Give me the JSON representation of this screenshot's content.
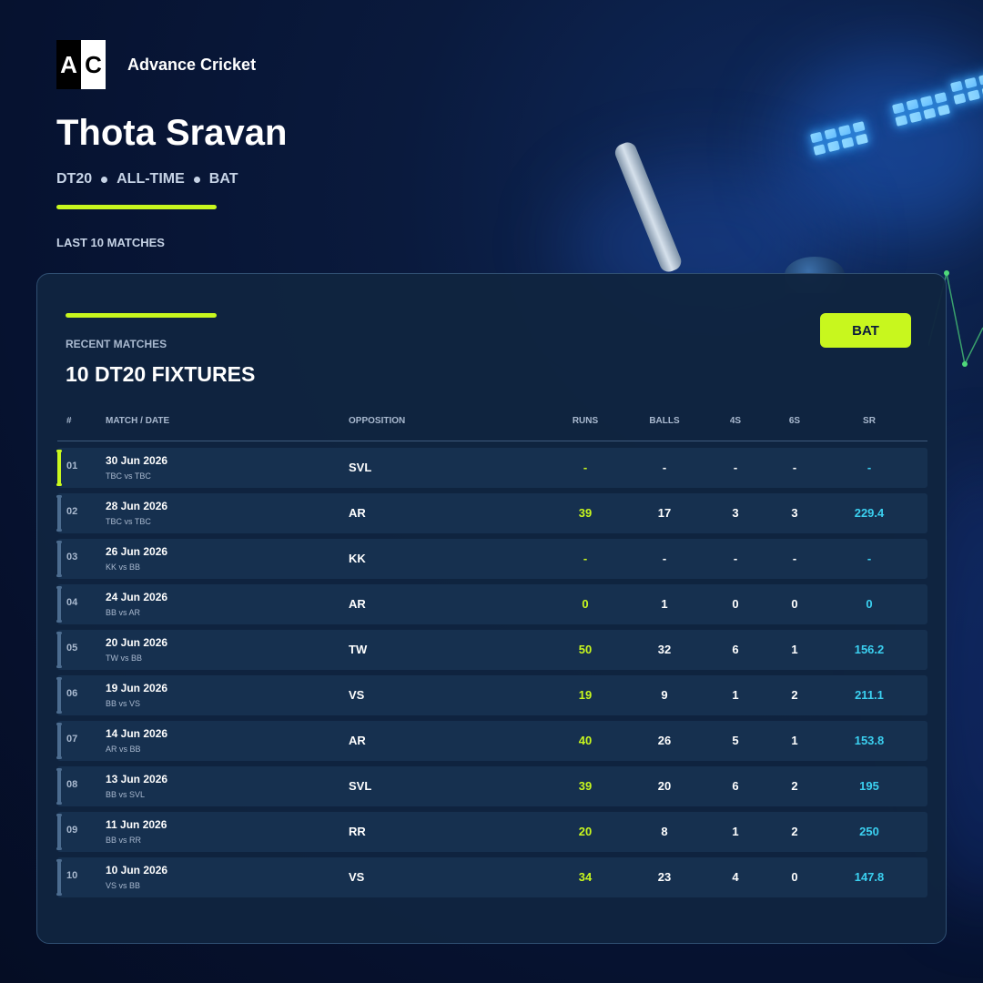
{
  "brand": {
    "logo_left": "A",
    "logo_right": "C",
    "name": "Advance Cricket"
  },
  "player": {
    "name": "Thota Sravan"
  },
  "meta": {
    "format": "DT20",
    "period": "ALL-TIME",
    "discipline": "BAT"
  },
  "section_label": "LAST 10 MATCHES",
  "card": {
    "kicker": "RECENT MATCHES",
    "title": "10 DT20 FIXTURES",
    "toggle_label": "BAT",
    "columns": {
      "num": "#",
      "match": "MATCH / DATE",
      "opposition": "OPPOSITION",
      "runs": "RUNS",
      "balls": "BALLS",
      "fours": "4S",
      "sixes": "6S",
      "sr": "SR"
    },
    "rows": [
      {
        "num": "01",
        "date": "30 Jun 2026",
        "match": "TBC vs TBC",
        "opposition": "SVL",
        "runs": "-",
        "balls": "-",
        "fours": "-",
        "sixes": "-",
        "sr": "-"
      },
      {
        "num": "02",
        "date": "28 Jun 2026",
        "match": "TBC vs TBC",
        "opposition": "AR",
        "runs": "39",
        "balls": "17",
        "fours": "3",
        "sixes": "3",
        "sr": "229.4"
      },
      {
        "num": "03",
        "date": "26 Jun 2026",
        "match": "KK vs BB",
        "opposition": "KK",
        "runs": "-",
        "balls": "-",
        "fours": "-",
        "sixes": "-",
        "sr": "-"
      },
      {
        "num": "04",
        "date": "24 Jun 2026",
        "match": "BB vs AR",
        "opposition": "AR",
        "runs": "0",
        "balls": "1",
        "fours": "0",
        "sixes": "0",
        "sr": "0"
      },
      {
        "num": "05",
        "date": "20 Jun 2026",
        "match": "TW vs BB",
        "opposition": "TW",
        "runs": "50",
        "balls": "32",
        "fours": "6",
        "sixes": "1",
        "sr": "156.2"
      },
      {
        "num": "06",
        "date": "19 Jun 2026",
        "match": "BB vs VS",
        "opposition": "VS",
        "runs": "19",
        "balls": "9",
        "fours": "1",
        "sixes": "2",
        "sr": "211.1"
      },
      {
        "num": "07",
        "date": "14 Jun 2026",
        "match": "AR vs BB",
        "opposition": "AR",
        "runs": "40",
        "balls": "26",
        "fours": "5",
        "sixes": "1",
        "sr": "153.8"
      },
      {
        "num": "08",
        "date": "13 Jun 2026",
        "match": "BB vs SVL",
        "opposition": "SVL",
        "runs": "39",
        "balls": "20",
        "fours": "6",
        "sixes": "2",
        "sr": "195"
      },
      {
        "num": "09",
        "date": "11 Jun 2026",
        "match": "BB vs RR",
        "opposition": "RR",
        "runs": "20",
        "balls": "8",
        "fours": "1",
        "sixes": "2",
        "sr": "250"
      },
      {
        "num": "10",
        "date": "10 Jun 2026",
        "match": "VS vs BB",
        "opposition": "VS",
        "runs": "34",
        "balls": "23",
        "fours": "4",
        "sixes": "0",
        "sr": "147.8"
      }
    ]
  },
  "colors": {
    "accent": "#c8f71e",
    "sr": "#3bd0f0",
    "background": "#061230",
    "card": "#102440"
  }
}
